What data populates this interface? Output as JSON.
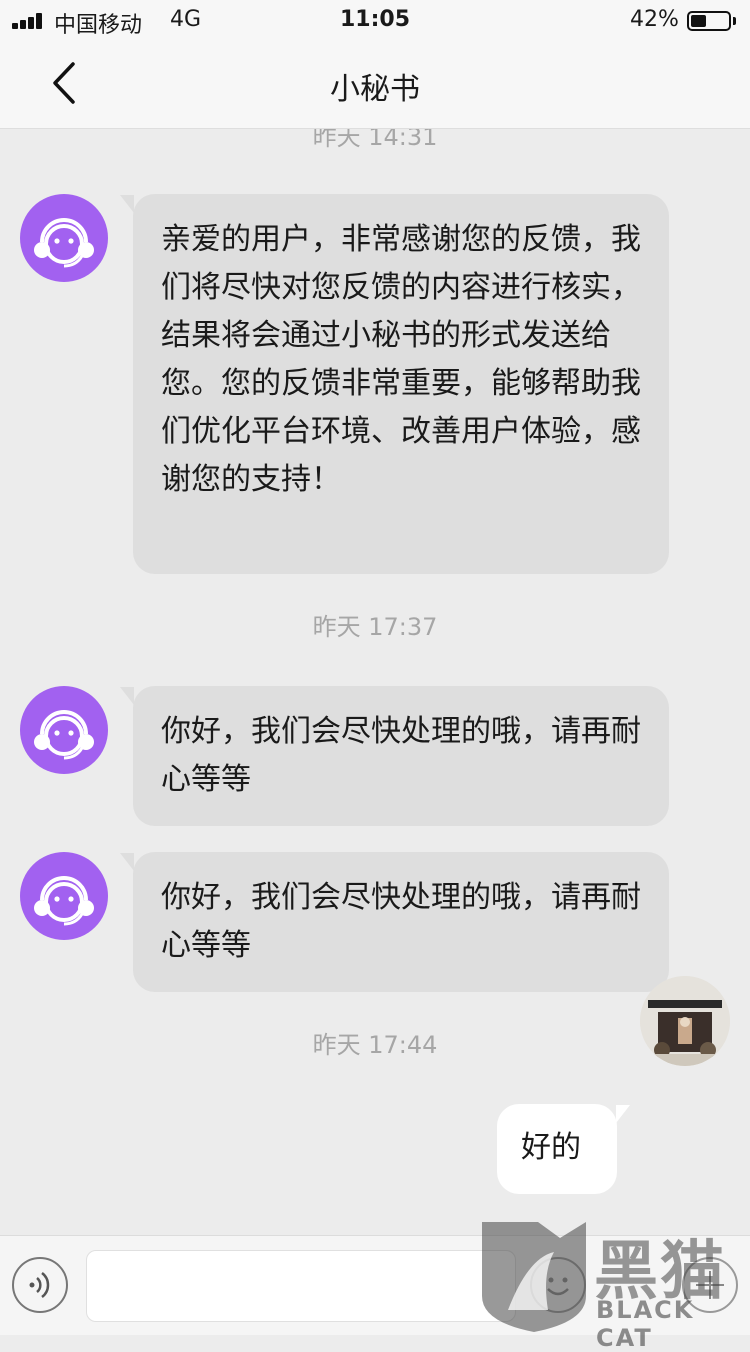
{
  "status_bar": {
    "carrier": "中国移动",
    "network": "4G",
    "time": "11:05",
    "battery_percent": "42%",
    "battery_level": 0.42
  },
  "nav": {
    "title": "小秘书",
    "back_icon": "chevron-left-icon"
  },
  "timestamps": [
    "昨天 14:31",
    "昨天 17:37",
    "昨天 17:44"
  ],
  "messages": [
    {
      "sender": "agent",
      "text": "亲爱的用户，非常感谢您的反馈，我们将尽快对您反馈的内容进行核实，结果将会通过小秘书的形式发送给您。您的反馈非常重要，能够帮助我们优化平台环境、改善用户体验，感谢您的支持！"
    },
    {
      "sender": "agent",
      "text": "你好，我们会尽快处理的哦，请再耐心等等"
    },
    {
      "sender": "agent",
      "text": "你好，我们会尽快处理的哦，请再耐心等等"
    },
    {
      "sender": "user",
      "text": "好的"
    }
  ],
  "input_bar": {
    "voice_icon": "voice-icon",
    "emoji_icon": "emoji-icon",
    "plus_icon": "plus-icon",
    "placeholder": ""
  },
  "watermark": {
    "brand": "黑猫",
    "brand_en": "BLACK CAT"
  },
  "colors": {
    "agent_avatar": "#a261f0",
    "agent_bubble": "#dedede",
    "user_bubble": "#ffffff",
    "background": "#ececec"
  }
}
